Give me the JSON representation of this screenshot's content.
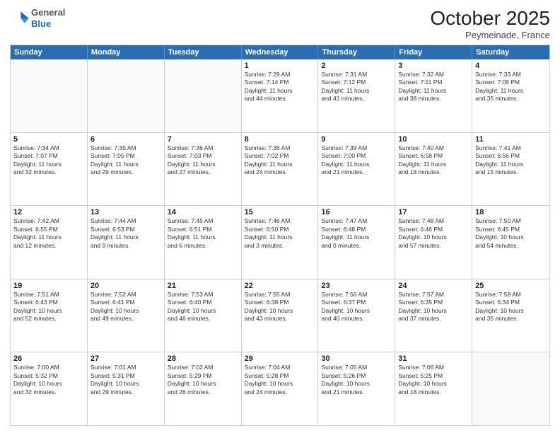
{
  "header": {
    "logo_general": "General",
    "logo_blue": "Blue",
    "title": "October 2025",
    "location": "Peymeinade, France"
  },
  "weekdays": [
    "Sunday",
    "Monday",
    "Tuesday",
    "Wednesday",
    "Thursday",
    "Friday",
    "Saturday"
  ],
  "rows": [
    [
      {
        "day": "",
        "text": ""
      },
      {
        "day": "",
        "text": ""
      },
      {
        "day": "",
        "text": ""
      },
      {
        "day": "1",
        "text": "Sunrise: 7:29 AM\nSunset: 7:14 PM\nDaylight: 11 hours\nand 44 minutes."
      },
      {
        "day": "2",
        "text": "Sunrise: 7:31 AM\nSunset: 7:12 PM\nDaylight: 11 hours\nand 41 minutes."
      },
      {
        "day": "3",
        "text": "Sunrise: 7:32 AM\nSunset: 7:11 PM\nDaylight: 11 hours\nand 38 minutes."
      },
      {
        "day": "4",
        "text": "Sunrise: 7:33 AM\nSunset: 7:09 PM\nDaylight: 11 hours\nand 35 minutes."
      }
    ],
    [
      {
        "day": "5",
        "text": "Sunrise: 7:34 AM\nSunset: 7:07 PM\nDaylight: 11 hours\nand 32 minutes."
      },
      {
        "day": "6",
        "text": "Sunrise: 7:35 AM\nSunset: 7:05 PM\nDaylight: 11 hours\nand 29 minutes."
      },
      {
        "day": "7",
        "text": "Sunrise: 7:36 AM\nSunset: 7:03 PM\nDaylight: 11 hours\nand 27 minutes."
      },
      {
        "day": "8",
        "text": "Sunrise: 7:38 AM\nSunset: 7:02 PM\nDaylight: 11 hours\nand 24 minutes."
      },
      {
        "day": "9",
        "text": "Sunrise: 7:39 AM\nSunset: 7:00 PM\nDaylight: 11 hours\nand 21 minutes."
      },
      {
        "day": "10",
        "text": "Sunrise: 7:40 AM\nSunset: 6:58 PM\nDaylight: 11 hours\nand 18 minutes."
      },
      {
        "day": "11",
        "text": "Sunrise: 7:41 AM\nSunset: 6:56 PM\nDaylight: 11 hours\nand 15 minutes."
      }
    ],
    [
      {
        "day": "12",
        "text": "Sunrise: 7:42 AM\nSunset: 6:55 PM\nDaylight: 11 hours\nand 12 minutes."
      },
      {
        "day": "13",
        "text": "Sunrise: 7:44 AM\nSunset: 6:53 PM\nDaylight: 11 hours\nand 9 minutes."
      },
      {
        "day": "14",
        "text": "Sunrise: 7:45 AM\nSunset: 6:51 PM\nDaylight: 11 hours\nand 6 minutes."
      },
      {
        "day": "15",
        "text": "Sunrise: 7:46 AM\nSunset: 6:50 PM\nDaylight: 11 hours\nand 3 minutes."
      },
      {
        "day": "16",
        "text": "Sunrise: 7:47 AM\nSunset: 6:48 PM\nDaylight: 11 hours\nand 0 minutes."
      },
      {
        "day": "17",
        "text": "Sunrise: 7:48 AM\nSunset: 6:46 PM\nDaylight: 10 hours\nand 57 minutes."
      },
      {
        "day": "18",
        "text": "Sunrise: 7:50 AM\nSunset: 6:45 PM\nDaylight: 10 hours\nand 54 minutes."
      }
    ],
    [
      {
        "day": "19",
        "text": "Sunrise: 7:51 AM\nSunset: 6:43 PM\nDaylight: 10 hours\nand 52 minutes."
      },
      {
        "day": "20",
        "text": "Sunrise: 7:52 AM\nSunset: 6:41 PM\nDaylight: 10 hours\nand 49 minutes."
      },
      {
        "day": "21",
        "text": "Sunrise: 7:53 AM\nSunset: 6:40 PM\nDaylight: 10 hours\nand 46 minutes."
      },
      {
        "day": "22",
        "text": "Sunrise: 7:55 AM\nSunset: 6:38 PM\nDaylight: 10 hours\nand 43 minutes."
      },
      {
        "day": "23",
        "text": "Sunrise: 7:56 AM\nSunset: 6:37 PM\nDaylight: 10 hours\nand 40 minutes."
      },
      {
        "day": "24",
        "text": "Sunrise: 7:57 AM\nSunset: 6:35 PM\nDaylight: 10 hours\nand 37 minutes."
      },
      {
        "day": "25",
        "text": "Sunrise: 7:58 AM\nSunset: 6:34 PM\nDaylight: 10 hours\nand 35 minutes."
      }
    ],
    [
      {
        "day": "26",
        "text": "Sunrise: 7:00 AM\nSunset: 5:32 PM\nDaylight: 10 hours\nand 32 minutes."
      },
      {
        "day": "27",
        "text": "Sunrise: 7:01 AM\nSunset: 5:31 PM\nDaylight: 10 hours\nand 29 minutes."
      },
      {
        "day": "28",
        "text": "Sunrise: 7:02 AM\nSunset: 5:29 PM\nDaylight: 10 hours\nand 26 minutes."
      },
      {
        "day": "29",
        "text": "Sunrise: 7:04 AM\nSunset: 5:28 PM\nDaylight: 10 hours\nand 24 minutes."
      },
      {
        "day": "30",
        "text": "Sunrise: 7:05 AM\nSunset: 5:26 PM\nDaylight: 10 hours\nand 21 minutes."
      },
      {
        "day": "31",
        "text": "Sunrise: 7:06 AM\nSunset: 5:25 PM\nDaylight: 10 hours\nand 18 minutes."
      },
      {
        "day": "",
        "text": ""
      }
    ]
  ]
}
